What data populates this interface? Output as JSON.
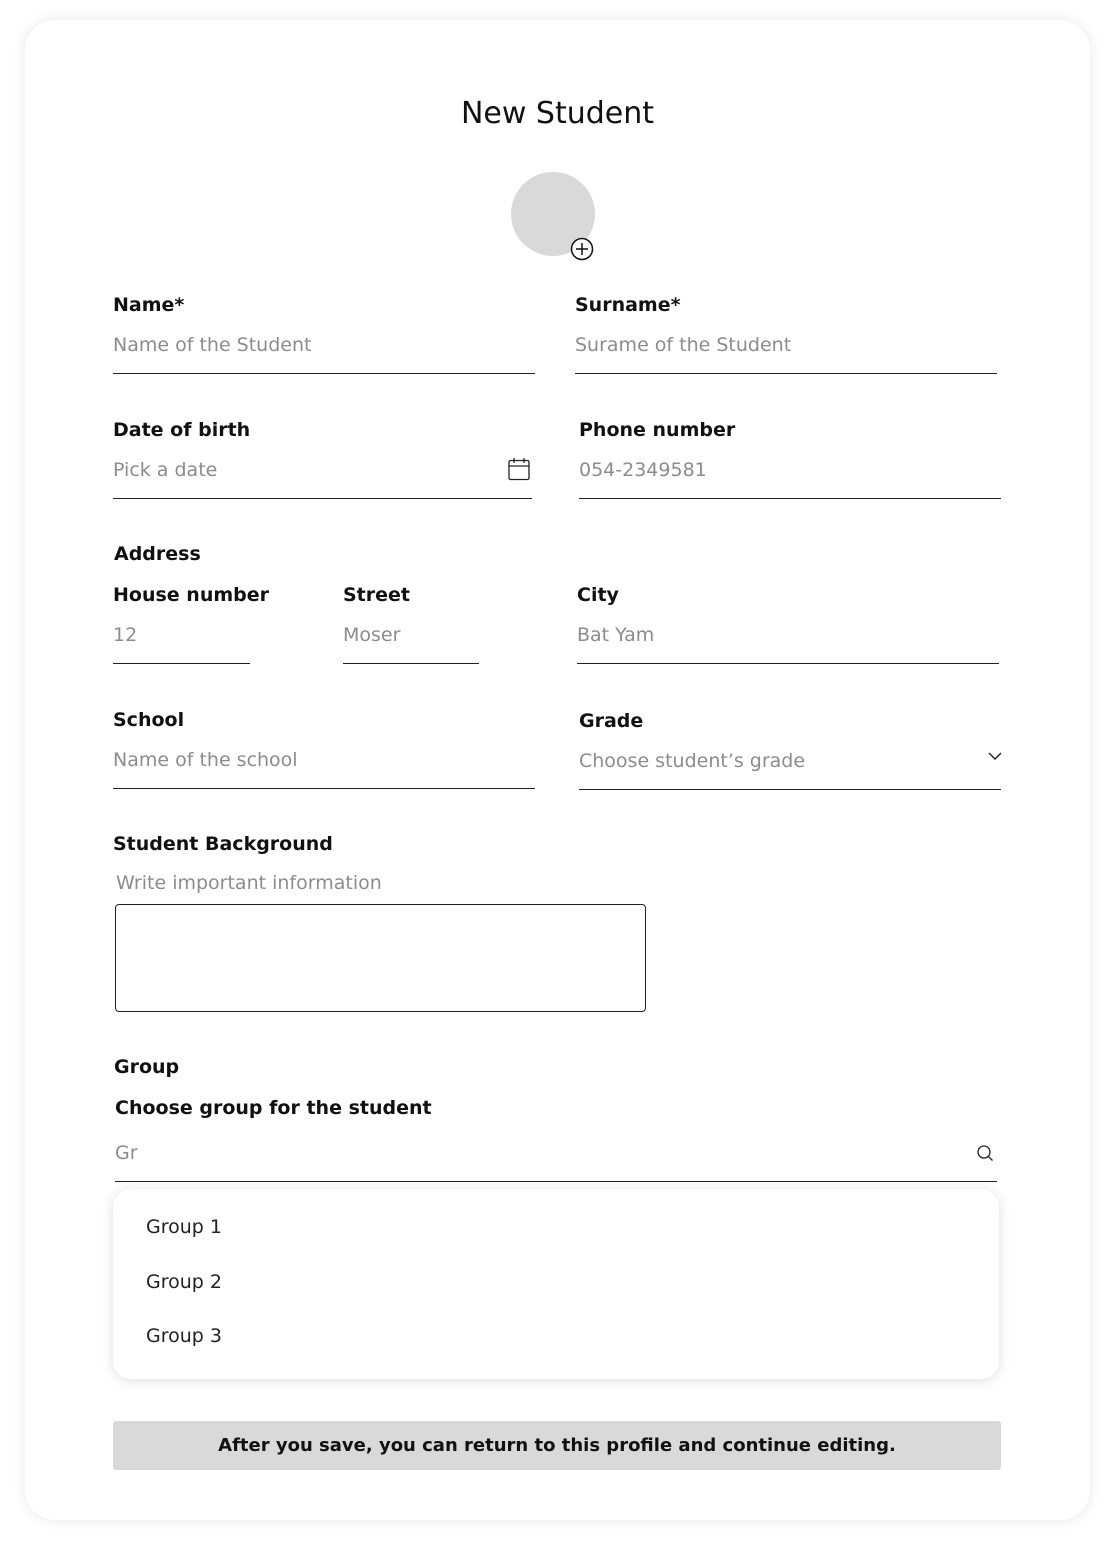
{
  "form": {
    "title": "New Student",
    "avatar": {
      "add_icon": "plus-circle-icon"
    }
  },
  "fields": {
    "name": {
      "label": "Name*",
      "placeholder": "Name of the Student"
    },
    "surname": {
      "label": "Surname*",
      "placeholder": "Surame of the Student"
    },
    "date_of_birth": {
      "label": "Date of birth",
      "placeholder": "Pick a date",
      "icon": "calendar-icon"
    },
    "phone": {
      "label": "Phone number",
      "placeholder": "054-2349581"
    },
    "address": {
      "label": "Address",
      "house_number": {
        "label": "House number",
        "placeholder": "12"
      },
      "street": {
        "label": "Street",
        "placeholder": "Moser"
      },
      "city": {
        "label": "City",
        "placeholder": "Bat Yam"
      }
    },
    "school": {
      "label": "School",
      "placeholder": "Name of the school"
    },
    "grade": {
      "label": "Grade",
      "placeholder": "Choose student’s grade",
      "icon": "chevron-down-icon"
    },
    "background": {
      "label": "Student Background",
      "hint": "Write important information",
      "value": ""
    },
    "group": {
      "label": "Group",
      "sublabel": "Choose group for the student",
      "search_value": "Gr",
      "icon": "search-icon",
      "options": [
        "Group 1",
        "Group 2",
        "Group 3"
      ]
    }
  },
  "notice": {
    "text": "After you save, you can return to this profile and continue editing."
  }
}
